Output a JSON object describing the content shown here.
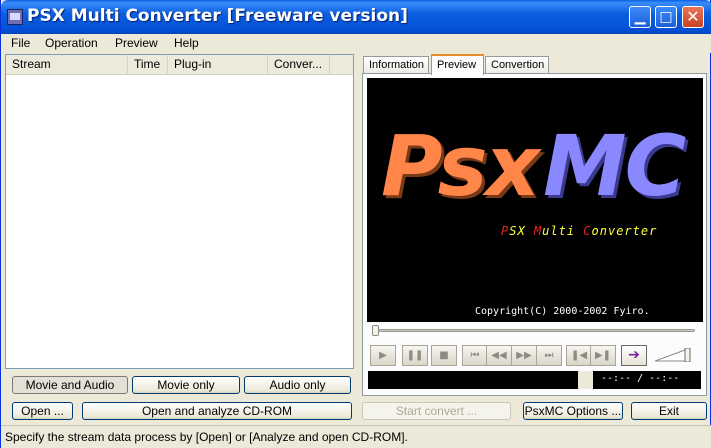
{
  "window": {
    "title": "PSX Multi Converter [Freeware version]"
  },
  "menu": [
    {
      "label": "File"
    },
    {
      "label": "Operation"
    },
    {
      "label": "Preview"
    },
    {
      "label": "Help"
    }
  ],
  "stream_list": {
    "columns": [
      "Stream",
      "Time",
      "Plug-in",
      "Conver..."
    ],
    "rows": []
  },
  "filter_buttons": {
    "movie_audio": "Movie and Audio",
    "movie_only": "Movie only",
    "audio_only": "Audio only",
    "selected": "movie_audio"
  },
  "actions": {
    "open": "Open ...",
    "open_analyze": "Open and analyze CD-ROM",
    "start_convert": "Start convert ...",
    "options": "PsxMC Options ...",
    "exit": "Exit"
  },
  "tabs": {
    "items": [
      "Information",
      "Preview",
      "Convertion"
    ],
    "active": "Preview"
  },
  "preview": {
    "logo_left": "Psx",
    "logo_right": "MC",
    "subtitle_parts": [
      "P",
      "SX ",
      "M",
      "ulti ",
      "C",
      "onverter"
    ],
    "copyright": "Copyright(C) 2000-2002 Fyiro.",
    "seek_fraction": 0.0,
    "time_display": "--:-- / --:--"
  },
  "player_controls": {
    "icons": [
      "play-icon",
      "pause-icon",
      "stop-icon",
      "skip-start-icon",
      "rewind-icon",
      "fast-forward-icon",
      "skip-end-icon",
      "step-back-icon",
      "step-forward-icon",
      "go-arrow-icon"
    ],
    "glyphs": [
      "▶",
      "❚❚",
      "■",
      "⏮",
      "◀◀",
      "▶▶",
      "⏭",
      "❚◀",
      "▶❚",
      "➔"
    ]
  },
  "status": {
    "text": "Specify the stream data process by [Open] or [Analyze and open CD-ROM]."
  },
  "colors": {
    "logo_orange": "#ff8548",
    "logo_purple": "#8a88ff",
    "subtitle_yellow": "#ffff40",
    "subtitle_red": "#e82020",
    "tab_accent": "#e68b2c"
  }
}
